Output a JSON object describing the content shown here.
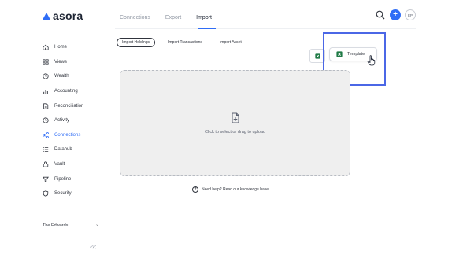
{
  "app": {
    "name": "asora"
  },
  "sidebar": {
    "items": [
      {
        "label": "Home",
        "icon": "home-icon"
      },
      {
        "label": "Views",
        "icon": "grid-icon"
      },
      {
        "label": "Wealth",
        "icon": "clock-icon"
      },
      {
        "label": "Accounting",
        "icon": "bar-chart-icon"
      },
      {
        "label": "Reconciliation",
        "icon": "document-icon"
      },
      {
        "label": "Activity",
        "icon": "clock-icon"
      },
      {
        "label": "Connections",
        "icon": "share-icon"
      },
      {
        "label": "Datahub",
        "icon": "list-icon"
      },
      {
        "label": "Vault",
        "icon": "lock-icon"
      },
      {
        "label": "Pipeline",
        "icon": "filter-icon"
      },
      {
        "label": "Security",
        "icon": "shield-icon"
      }
    ],
    "active_index": 6,
    "account_name": "The Edwards",
    "account_chevron": "›",
    "collapse_glyph": "<<"
  },
  "header": {
    "tabs": [
      {
        "label": "Connections"
      },
      {
        "label": "Export"
      },
      {
        "label": "Import"
      }
    ],
    "active_tab": "Import",
    "avatar_initials": "EP"
  },
  "import": {
    "sub_tabs": [
      {
        "label": "Import Holdings"
      },
      {
        "label": "Import Transactions"
      },
      {
        "label": "Import Asset"
      }
    ],
    "template_label": "Template",
    "dropzone_text": "Click to select or drag to upload",
    "help_text": "Need help? Read our knowledge base"
  },
  "colors": {
    "accent": "#2f6df6",
    "highlight": "#4b67e6",
    "excel_green": "#1f7a45",
    "dropzone_bg": "#efefef"
  }
}
